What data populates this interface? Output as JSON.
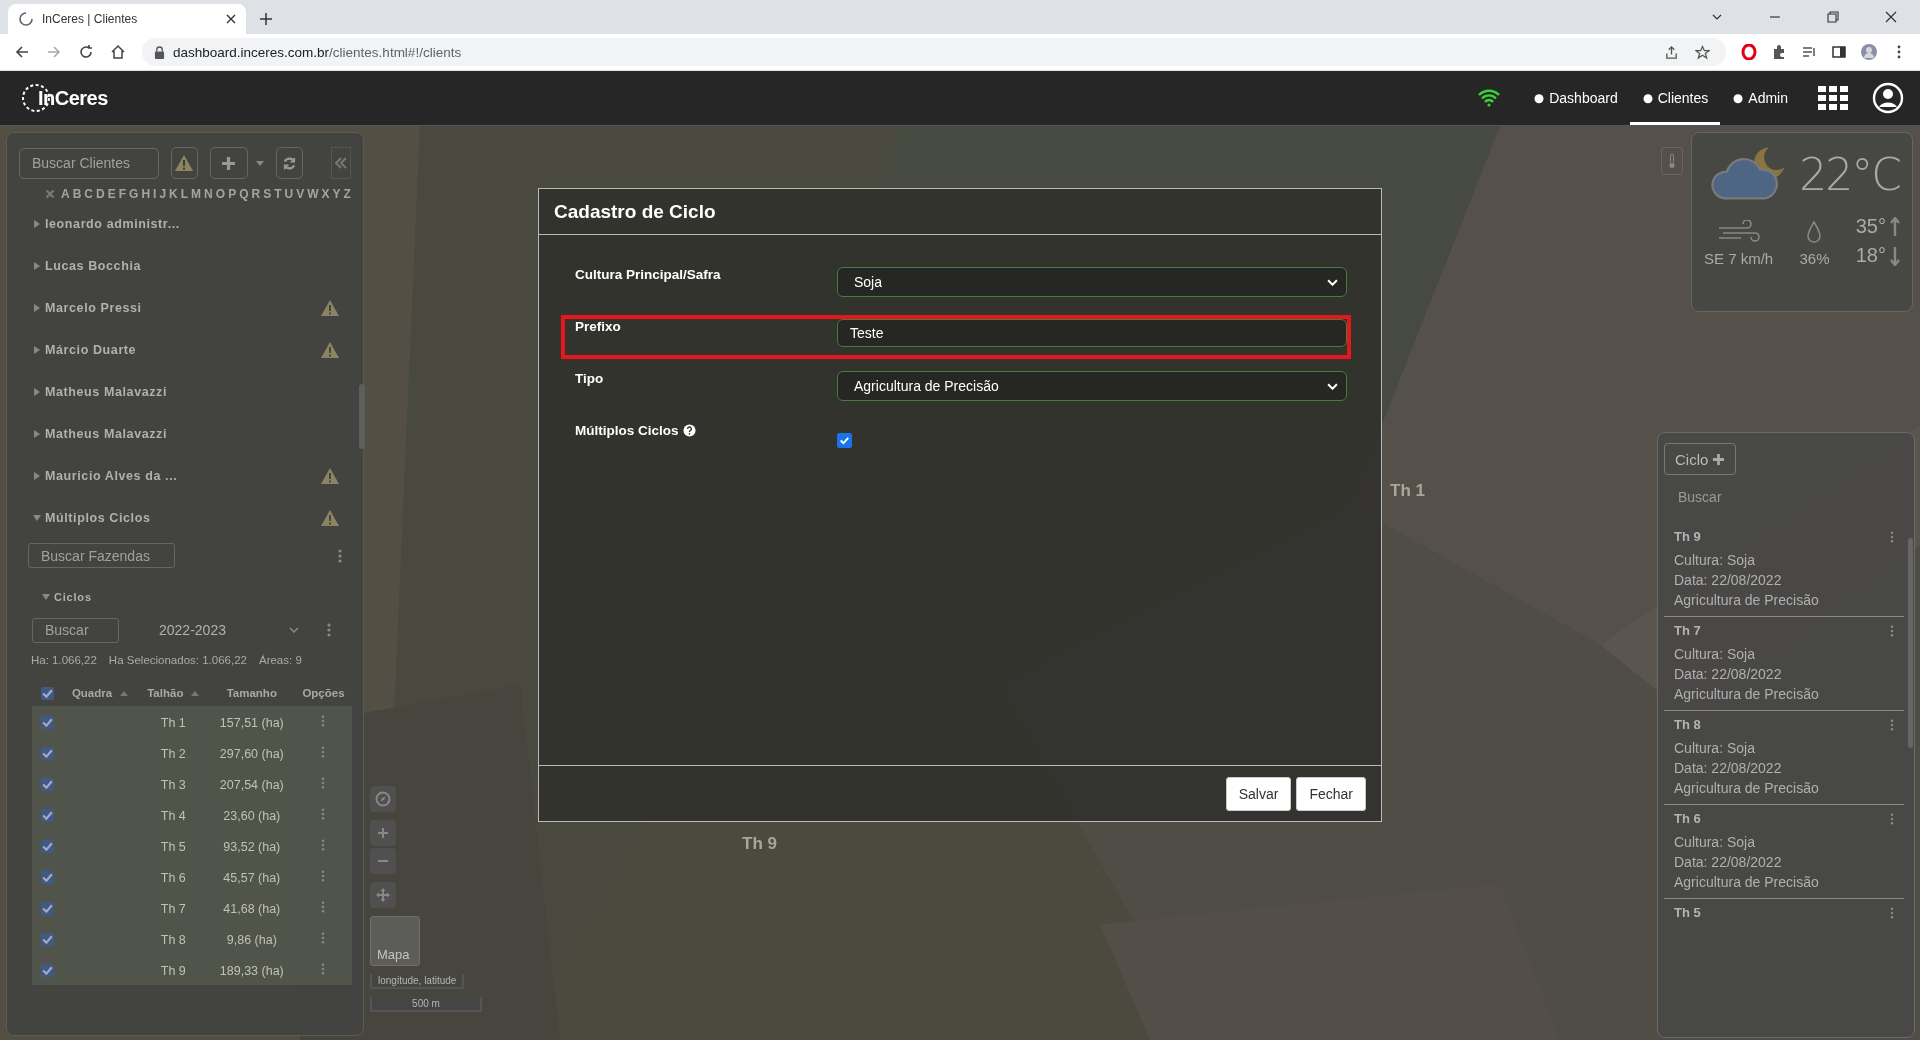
{
  "browser": {
    "tab_title": "InCeres | Clientes",
    "url_domain": "dashboard.inceres.com.br",
    "url_path": "/clientes.html#!/clients"
  },
  "header": {
    "logo": "InCeres",
    "nav": [
      {
        "label": "Dashboard",
        "selected": false
      },
      {
        "label": "Clientes",
        "selected": true
      },
      {
        "label": "Admin",
        "selected": false
      }
    ]
  },
  "clients_panel": {
    "search_placeholder": "Buscar Clientes",
    "alphabet": [
      "A",
      "B",
      "C",
      "D",
      "E",
      "F",
      "G",
      "H",
      "I",
      "J",
      "K",
      "L",
      "M",
      "N",
      "O",
      "P",
      "Q",
      "R",
      "S",
      "T",
      "U",
      "V",
      "W",
      "X",
      "Y",
      "Z"
    ],
    "clients": [
      {
        "name": "leonardo administr...",
        "warning": false,
        "expanded": false
      },
      {
        "name": "Lucas Bocchia",
        "warning": false,
        "expanded": false
      },
      {
        "name": "Marcelo Pressi",
        "warning": true,
        "expanded": false
      },
      {
        "name": "Márcio Duarte",
        "warning": true,
        "expanded": false
      },
      {
        "name": "Matheus Malavazzi",
        "warning": false,
        "expanded": false
      },
      {
        "name": "Matheus Malavazzi",
        "warning": false,
        "expanded": false
      },
      {
        "name": "Mauricio Alves da ...",
        "warning": true,
        "expanded": false
      },
      {
        "name": "Múltiplos Ciclos",
        "warning": true,
        "expanded": true
      }
    ],
    "farm_search_placeholder": "Buscar Fazendas",
    "cycles": {
      "title": "Ciclos",
      "expanded": true,
      "search_placeholder": "Buscar",
      "season": "2022-2023",
      "stats": [
        "Ha: 1.066,22",
        "Ha Selecionados: 1.066,22",
        "Áreas: 9"
      ],
      "columns": [
        "Quadra",
        "Talhão",
        "Tamanho",
        "Opções"
      ],
      "all_checked": true,
      "rows": [
        {
          "checked": true,
          "talhao": "Th 1",
          "tamanho": "157,51 (ha)"
        },
        {
          "checked": true,
          "talhao": "Th 2",
          "tamanho": "297,60 (ha)"
        },
        {
          "checked": true,
          "talhao": "Th 3",
          "tamanho": "207,54 (ha)"
        },
        {
          "checked": true,
          "talhao": "Th 4",
          "tamanho": "23,60 (ha)"
        },
        {
          "checked": true,
          "talhao": "Th 5",
          "tamanho": "93,52 (ha)"
        },
        {
          "checked": true,
          "talhao": "Th 6",
          "tamanho": "45,57 (ha)"
        },
        {
          "checked": true,
          "talhao": "Th 7",
          "tamanho": "41,68 (ha)"
        },
        {
          "checked": true,
          "talhao": "Th 8",
          "tamanho": "9,86 (ha)"
        },
        {
          "checked": true,
          "talhao": "Th 9",
          "tamanho": "189,33 (ha)"
        }
      ]
    }
  },
  "map": {
    "labels": [
      {
        "text": "Th 9"
      },
      {
        "text": "Th 1"
      }
    ],
    "layer_label": "Mapa",
    "coordinates": "longitude, latitude",
    "scale": "500 m"
  },
  "weather": {
    "temperature": "22°C",
    "wind": "SE 7 km/h",
    "humidity": "36%",
    "max": "35°",
    "min": "18°"
  },
  "cycles_panel": {
    "add_button": "Ciclo",
    "search_placeholder": "Buscar",
    "cards": [
      {
        "title": "Th 9",
        "lines": [
          "Cultura: Soja",
          "Data: 22/08/2022",
          "Agricultura de Precisão"
        ]
      },
      {
        "title": "Th 7",
        "lines": [
          "Cultura: Soja",
          "Data: 22/08/2022",
          "Agricultura de Precisão"
        ]
      },
      {
        "title": "Th 8",
        "lines": [
          "Cultura: Soja",
          "Data: 22/08/2022",
          "Agricultura de Precisão"
        ]
      },
      {
        "title": "Th 6",
        "lines": [
          "Cultura: Soja",
          "Data: 22/08/2022",
          "Agricultura de Precisão"
        ]
      },
      {
        "title": "Th 5"
      }
    ]
  },
  "modal": {
    "title": "Cadastro de Ciclo",
    "fields": [
      {
        "label": "Cultura Principal/Safra",
        "kind": "select",
        "value": "Soja",
        "highlighted": false
      },
      {
        "label": "Prefixo",
        "kind": "input",
        "value": "Teste",
        "highlighted": true
      },
      {
        "label": "Tipo",
        "kind": "select",
        "value": "Agricultura de Precisão",
        "highlighted": false
      },
      {
        "label": "Múltiplos Ciclos",
        "kind": "checkbox",
        "help": true,
        "checked": true,
        "highlighted": false
      }
    ],
    "buttons": [
      "Salvar",
      "Fechar"
    ]
  }
}
